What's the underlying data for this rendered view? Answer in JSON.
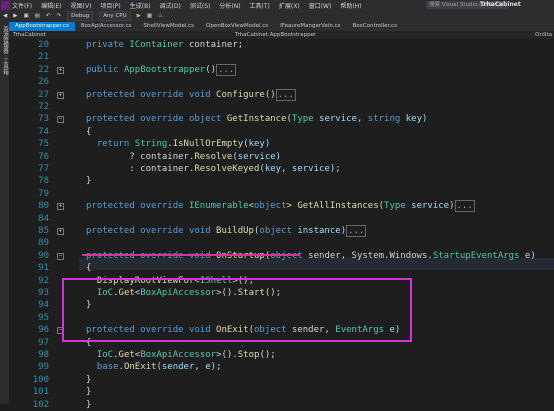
{
  "menu": [
    "文件(F)",
    "编辑(E)",
    "视图(V)",
    "项目(P)",
    "生成(B)",
    "调试(D)",
    "测试(S)",
    "分析(N)",
    "工具(T)",
    "扩展(X)",
    "窗口(W)",
    "帮助(H)"
  ],
  "search": {
    "placeholder": "搜索 Visual Studio (Ctrl+Q)"
  },
  "app_title": "TrhaCabinet",
  "toolbar": {
    "config": "Debug",
    "platform": "Any CPU"
  },
  "tabs": [
    "AppBootstrapper.cs",
    "BoxApiAccessor.cs",
    "ShellViewModel.cs",
    "OpenBoxViewModel.cs",
    "IFeaureMangerVein.cs",
    "BoxController.cs"
  ],
  "sidebar": {
    "items": [
      "资源管理器",
      "工具箱"
    ]
  },
  "nav": {
    "left": "TrhaCabinet",
    "mid": "TrhaCabinet.AppBootstrapper",
    "right": "OnSta"
  },
  "lines": [
    {
      "n": "20",
      "tokens": [
        {
          "t": "private ",
          "c": "kw"
        },
        {
          "t": "IContainer",
          "c": "ty"
        },
        {
          "t": " container;",
          "c": "tx"
        }
      ]
    },
    {
      "n": "21",
      "tokens": []
    },
    {
      "n": "22",
      "tokens": [
        {
          "t": "public ",
          "c": "kw"
        },
        {
          "t": "AppBootstrapper",
          "c": "ty"
        },
        {
          "t": "()",
          "c": "tx"
        },
        {
          "t": "...",
          "c": "collapsed"
        }
      ]
    },
    {
      "n": "26",
      "tokens": []
    },
    {
      "n": "27",
      "tokens": [
        {
          "t": "protected override void ",
          "c": "kw"
        },
        {
          "t": "Configure",
          "c": "fn"
        },
        {
          "t": "()",
          "c": "tx"
        },
        {
          "t": "...",
          "c": "collapsed"
        }
      ]
    },
    {
      "n": "72",
      "tokens": []
    },
    {
      "n": "73",
      "tokens": [
        {
          "t": "protected override object ",
          "c": "kw"
        },
        {
          "t": "GetInstance",
          "c": "fn"
        },
        {
          "t": "(",
          "c": "tx"
        },
        {
          "t": "Type",
          "c": "ty"
        },
        {
          "t": " service, ",
          "c": "pm"
        },
        {
          "t": "string",
          "c": "kw"
        },
        {
          "t": " key)",
          "c": "pm"
        }
      ]
    },
    {
      "n": "74",
      "tokens": [
        {
          "t": "{",
          "c": "tx"
        }
      ]
    },
    {
      "n": "75",
      "tokens": [
        {
          "t": "  return ",
          "c": "kw"
        },
        {
          "t": "String",
          "c": "ty"
        },
        {
          "t": ".",
          "c": "tx"
        },
        {
          "t": "IsNullOrEmpty",
          "c": "fn"
        },
        {
          "t": "(key)",
          "c": "pm"
        }
      ]
    },
    {
      "n": "76",
      "tokens": [
        {
          "t": "        ? container.",
          "c": "tx"
        },
        {
          "t": "Resolve",
          "c": "fn"
        },
        {
          "t": "(service)",
          "c": "pm"
        }
      ]
    },
    {
      "n": "77",
      "tokens": [
        {
          "t": "        : container.",
          "c": "tx"
        },
        {
          "t": "ResolveKeyed",
          "c": "fn"
        },
        {
          "t": "(key, service);",
          "c": "pm"
        }
      ]
    },
    {
      "n": "78",
      "tokens": [
        {
          "t": "}",
          "c": "tx"
        }
      ]
    },
    {
      "n": "79",
      "tokens": []
    },
    {
      "n": "80",
      "tokens": [
        {
          "t": "protected override ",
          "c": "kw"
        },
        {
          "t": "IEnumerable",
          "c": "ty"
        },
        {
          "t": "<",
          "c": "tx"
        },
        {
          "t": "object",
          "c": "kw"
        },
        {
          "t": "> ",
          "c": "tx"
        },
        {
          "t": "GetAllInstances",
          "c": "fn"
        },
        {
          "t": "(",
          "c": "tx"
        },
        {
          "t": "Type",
          "c": "ty"
        },
        {
          "t": " service)",
          "c": "pm"
        },
        {
          "t": "...",
          "c": "collapsed"
        }
      ]
    },
    {
      "n": "84",
      "tokens": []
    },
    {
      "n": "85",
      "tokens": [
        {
          "t": "protected override void ",
          "c": "kw"
        },
        {
          "t": "BuildUp",
          "c": "fn"
        },
        {
          "t": "(",
          "c": "tx"
        },
        {
          "t": "object",
          "c": "kw"
        },
        {
          "t": " instance)",
          "c": "pm"
        },
        {
          "t": "...",
          "c": "collapsed"
        }
      ]
    },
    {
      "n": "89",
      "tokens": []
    },
    {
      "n": "90",
      "tokens": [
        {
          "t": "protected override void ",
          "c": "kw"
        },
        {
          "t": "OnStartup",
          "c": "fn"
        },
        {
          "t": "(",
          "c": "tx"
        },
        {
          "t": "object",
          "c": "kw"
        },
        {
          "t": " sender, System.Windows.",
          "c": "tx"
        },
        {
          "t": "StartupEventArgs",
          "c": "ty"
        },
        {
          "t": " e)",
          "c": "pm"
        }
      ]
    },
    {
      "n": "91",
      "tokens": [
        {
          "t": "{",
          "c": "tx"
        }
      ]
    },
    {
      "n": "92",
      "tokens": [
        {
          "t": "  ",
          "c": "tx"
        },
        {
          "t": "DisplayRootViewFor",
          "c": "fn"
        },
        {
          "t": "<",
          "c": "tx"
        },
        {
          "t": "IShell",
          "c": "ty"
        },
        {
          "t": ">();",
          "c": "tx"
        }
      ]
    },
    {
      "n": "93",
      "tokens": [
        {
          "t": "  ",
          "c": "tx"
        },
        {
          "t": "IoC",
          "c": "ty"
        },
        {
          "t": ".",
          "c": "tx"
        },
        {
          "t": "Get",
          "c": "fn"
        },
        {
          "t": "<",
          "c": "tx"
        },
        {
          "t": "BoxApiAccessor",
          "c": "ty"
        },
        {
          "t": ">().",
          "c": "tx"
        },
        {
          "t": "Start",
          "c": "fn"
        },
        {
          "t": "();",
          "c": "tx"
        }
      ]
    },
    {
      "n": "94",
      "tokens": [
        {
          "t": "}",
          "c": "tx"
        }
      ]
    },
    {
      "n": "95",
      "tokens": []
    },
    {
      "n": "96",
      "tokens": [
        {
          "t": "protected override void ",
          "c": "kw"
        },
        {
          "t": "OnExit",
          "c": "fn"
        },
        {
          "t": "(",
          "c": "tx"
        },
        {
          "t": "object",
          "c": "kw"
        },
        {
          "t": " sender, ",
          "c": "tx"
        },
        {
          "t": "EventArgs",
          "c": "ty"
        },
        {
          "t": " e)",
          "c": "pm"
        }
      ]
    },
    {
      "n": "97",
      "tokens": [
        {
          "t": "{",
          "c": "tx"
        }
      ]
    },
    {
      "n": "98",
      "tokens": [
        {
          "t": "  ",
          "c": "tx"
        },
        {
          "t": "IoC",
          "c": "ty"
        },
        {
          "t": ".",
          "c": "tx"
        },
        {
          "t": "Get",
          "c": "fn"
        },
        {
          "t": "<",
          "c": "tx"
        },
        {
          "t": "BoxApiAccessor",
          "c": "ty"
        },
        {
          "t": ">().",
          "c": "tx"
        },
        {
          "t": "Stop",
          "c": "fn"
        },
        {
          "t": "();",
          "c": "tx"
        }
      ]
    },
    {
      "n": "99",
      "tokens": [
        {
          "t": "  ",
          "c": "tx"
        },
        {
          "t": "base",
          "c": "kw"
        },
        {
          "t": ".",
          "c": "tx"
        },
        {
          "t": "OnExit",
          "c": "fn"
        },
        {
          "t": "(sender, e);",
          "c": "pm"
        }
      ]
    },
    {
      "n": "100",
      "tokens": [
        {
          "t": "}",
          "c": "tx"
        }
      ]
    },
    {
      "n": "101",
      "tokens": [
        {
          "t": "}",
          "c": "tx"
        }
      ]
    },
    {
      "n": "102",
      "tokens": [
        {
          "t": "}",
          "c": "tx"
        }
      ]
    }
  ],
  "colors": {
    "keyword": "#569cd6",
    "type": "#4ec9b0",
    "method": "#dcdcaa",
    "param": "#9cdcfe",
    "accent": "#007acc",
    "annotation": "#d633d6"
  }
}
